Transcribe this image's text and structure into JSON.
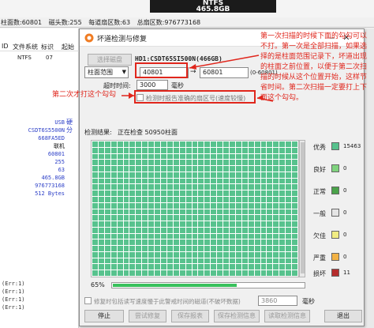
{
  "background": {
    "disk_name": "NTFS",
    "disk_size": "465.8GB",
    "stats": [
      "柱面数:60801",
      "磁头数:255",
      "每道扇区数:63",
      "总扇区数:976773168"
    ],
    "table_headers": [
      "ID",
      "文件系统",
      "标识",
      "起始"
    ],
    "table_row": {
      "fs": "NTFS",
      "id": "07"
    },
    "info_lines": [
      "USB",
      "CSDT6S5500N",
      "668FA5ED",
      "联机",
      "",
      "60801",
      "255",
      "63",
      "465.8GB",
      "976773168",
      "512 Bytes"
    ],
    "info_side": [
      "硬",
      "分"
    ],
    "log_lines": [
      "(Err:1)",
      "(Err:1)",
      "(Err:1)",
      "(Err:1)"
    ]
  },
  "dialog": {
    "title": "坏道检测与修复",
    "select_disk_button": "选择磁盘",
    "disk_label": "HD1:CSDT65SI500N(466GB)",
    "range_type": "柱面范围",
    "range_from": "40801",
    "range_to": "60801",
    "range_hint": "(0-60801)",
    "timeout_label": "超时时间:",
    "timeout_value": "3000",
    "timeout_unit": "毫秒",
    "report_checkbox_label": "检测时报告准确的扇区号(速度较慢)",
    "result_label": "检测结果:",
    "result_status": "正在检查 50950柱面",
    "progress_text": "65%",
    "progress_value": 0.65,
    "repair_checkbox_label": "修复时包括读写速度慢于此警戒时间的磁道(不破坏数据)",
    "repair_value": "3860",
    "repair_unit": "毫秒",
    "buttons": [
      "停止",
      "尝试修复",
      "保存报表",
      "保存检测信息",
      "读取检测信息",
      "退出"
    ],
    "legend": [
      {
        "label": "优秀",
        "color": "#57c28d",
        "count": "15463"
      },
      {
        "label": "良好",
        "color": "#7fd37e",
        "count": "0"
      },
      {
        "label": "正常",
        "color": "#4aa34a",
        "count": "0"
      },
      {
        "label": "一般",
        "color": "#e5e5e5",
        "count": "0"
      },
      {
        "label": "欠佳",
        "color": "#f1ed83",
        "count": "0"
      },
      {
        "label": "严重",
        "color": "#f2b245",
        "count": "0"
      },
      {
        "label": "损坏",
        "color": "#b52d2d",
        "count": "11"
      }
    ]
  },
  "annotations": {
    "left_note": "第二次才打这个勾勾",
    "right_note": "第一次扫描的时候下面的勾勾可以不打。第一次是全部扫描，如果选择的是柱面范围记录下，坏道出现的柱面之前位置，以便于第二次扫描的时候从这个位置开始，这样节省时间。第二次扫描一定要打上下面这个勾勾。"
  }
}
